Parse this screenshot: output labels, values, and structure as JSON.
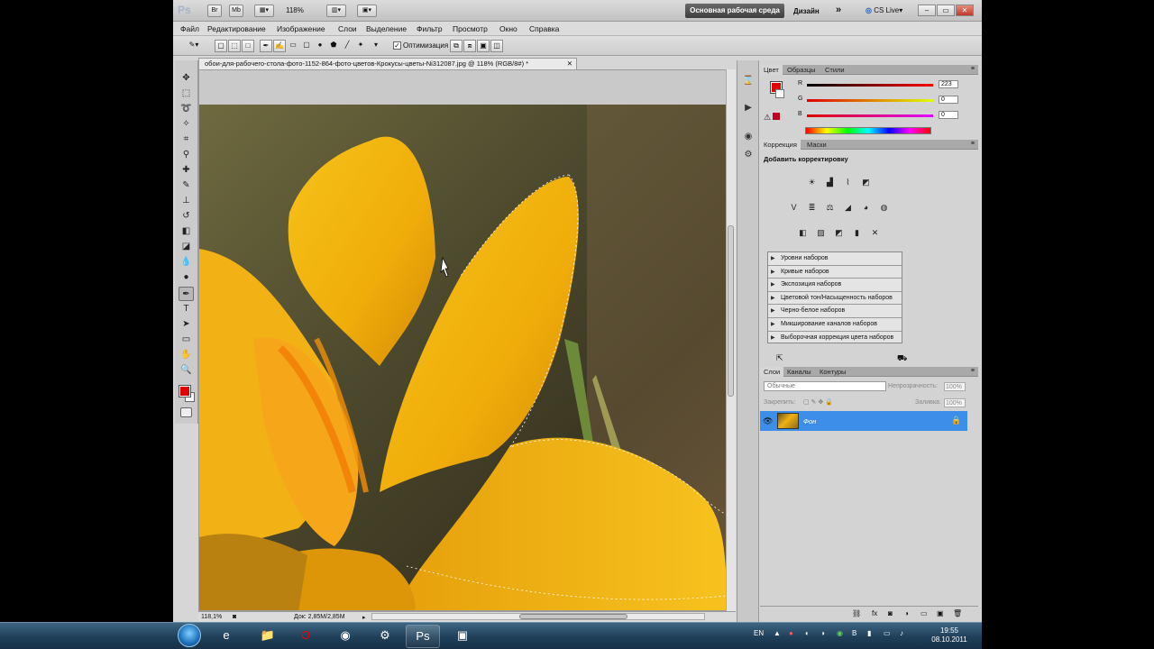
{
  "appbar": {
    "logo": "Ps",
    "zoom": "118%",
    "workspace_active": "Основная рабочая среда",
    "workspace_design": "Дизайн",
    "more": "»",
    "cslive": "CS Live"
  },
  "menu": [
    "Файл",
    "Редактирование",
    "Изображение",
    "Слои",
    "Выделение",
    "Фильтр",
    "Просмотр",
    "Окно",
    "Справка"
  ],
  "options": {
    "optimization_label": "Оптимизация",
    "optimization_checked": true
  },
  "document": {
    "tab_title": "обои-для-рабочего-стола-фото-1152-864-фото-цветов-Крокусы-цветы-Ni312087.jpg @ 118% (RGB/8#) *",
    "zoom_status": "118,1%",
    "doc_size": "Док: 2,85M/2,85M"
  },
  "color_panel": {
    "tabs": [
      "Цвет",
      "Образцы",
      "Стили"
    ],
    "r_label": "R",
    "g_label": "G",
    "b_label": "B",
    "r_value": "223",
    "g_value": "0",
    "b_value": "0",
    "foreground": "#df0000"
  },
  "adjustments_panel": {
    "tabs": [
      "Коррекция",
      "Маски"
    ],
    "title": "Добавить корректировку",
    "presets": [
      "Уровни наборов",
      "Кривые наборов",
      "Экспозиция наборов",
      "Цветовой тон/Насыщенность наборов",
      "Черно-белое наборов",
      "Микширование каналов наборов",
      "Выборочная коррекция цвета наборов"
    ]
  },
  "layers_panel": {
    "tabs": [
      "Слои",
      "Каналы",
      "Контуры"
    ],
    "blend_mode": "Обычные",
    "opacity_label": "Непрозрачность:",
    "opacity_value": "100%",
    "lock_label": "Закрепить:",
    "fill_label": "Заливка:",
    "fill_value": "100%",
    "layer_name": "Фон"
  },
  "taskbar": {
    "lang": "EN",
    "time": "19:55",
    "date": "08.10.2011"
  }
}
